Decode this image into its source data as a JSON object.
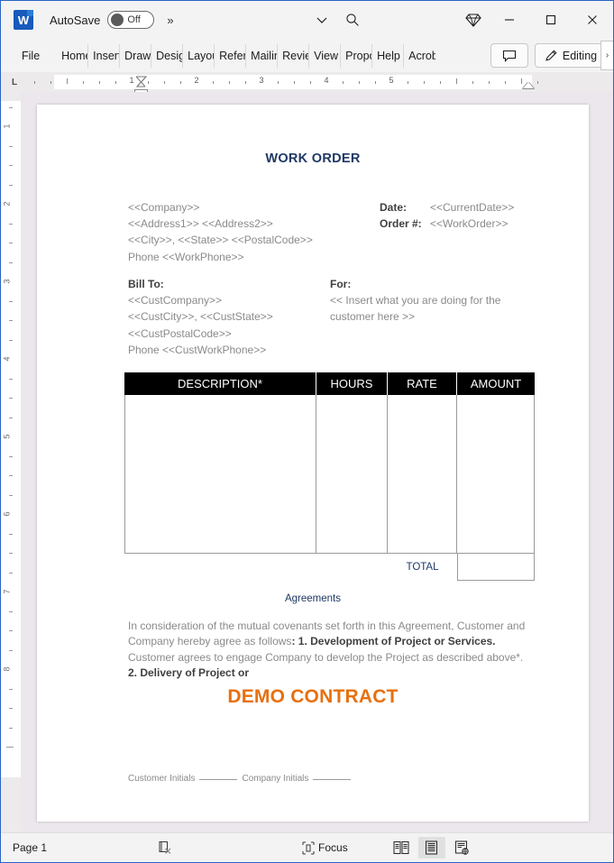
{
  "titlebar": {
    "app_logo": "word-logo",
    "autosave_label": "AutoSave",
    "autosave_state": "Off",
    "more_commands": "»",
    "customize_caret": "∨",
    "search_icon": "search-icon",
    "copilot_icon": "diamond-icon",
    "minimize": "—",
    "maximize": "☐",
    "close": "✕"
  },
  "ribbon": {
    "tabs": [
      {
        "label": "File"
      },
      {
        "label": "Home"
      },
      {
        "label": "Insert"
      },
      {
        "label": "Draw"
      },
      {
        "label": "Design"
      },
      {
        "label": "Layout"
      },
      {
        "label": "References"
      },
      {
        "label": "Mailings"
      },
      {
        "label": "Review"
      },
      {
        "label": "View"
      },
      {
        "label": "Proposify"
      },
      {
        "label": "Help"
      },
      {
        "label": "Acrobat"
      }
    ],
    "comment_button": "comment-icon",
    "editing_button": "Editing",
    "editing_icon": "pencil-icon",
    "expand_caret": "›"
  },
  "ruler": {
    "horizontal_numbers": [
      "1",
      "2",
      "3",
      "4",
      "5"
    ],
    "vertical_numbers": [
      "1",
      "2",
      "3",
      "4",
      "5",
      "6",
      "7",
      "8"
    ],
    "tab_stop_indicator": "L"
  },
  "document": {
    "title": "WORK ORDER",
    "company_block": [
      "<<Company>>",
      "<<Address1>> <<Address2>>",
      "<<City>>, <<State>> <<PostalCode>>",
      "Phone <<WorkPhone>>"
    ],
    "date_rows": [
      {
        "label": "Date:",
        "value": "<<CurrentDate>>"
      },
      {
        "label": "Order #:",
        "value": "<<WorkOrder>>"
      }
    ],
    "bill_to": {
      "heading": "Bill To:",
      "lines": [
        "<<CustCompany>>",
        "<<CustCity>>, <<CustState>>",
        "<<CustPostalCode>>",
        "Phone <<CustWorkPhone>>"
      ]
    },
    "for": {
      "heading": "For:",
      "text": "<< Insert what you are doing for the customer here >>"
    },
    "table": {
      "headers": [
        "DESCRIPTION*",
        "HOURS",
        "RATE",
        "AMOUNT"
      ],
      "rows": [],
      "total_label": "TOTAL",
      "total_value": ""
    },
    "agreements_heading": "Agreements",
    "agreements_text_1": "In consideration of the mutual covenants set forth in this Agreement, Customer and Company hereby agree as follows",
    "agreements_bold_1": ": 1. Development of Project or Services.",
    "agreements_text_2": " Customer agrees to engage Company to develop the Project as described above*. ",
    "agreements_bold_2": "2. Delivery of Project or",
    "watermark": "DEMO CONTRACT",
    "initials": {
      "customer_label": "Customer Initials",
      "company_label": "Company Initials"
    },
    "colors": {
      "title_blue": "#1f3864",
      "watermark_orange": "#e8700f",
      "table_header_bg": "#000000",
      "body_gray": "#8a8a8a"
    }
  },
  "statusbar": {
    "page_label": "Page 1",
    "proofing_icon": "proofing-errors-icon",
    "focus_label": "Focus",
    "focus_icon": "focus-icon",
    "views": [
      {
        "name": "read-mode",
        "icon": "read-mode-icon",
        "active": false
      },
      {
        "name": "print-layout",
        "icon": "print-layout-icon",
        "active": true
      },
      {
        "name": "web-layout",
        "icon": "web-layout-icon",
        "active": false
      }
    ]
  }
}
